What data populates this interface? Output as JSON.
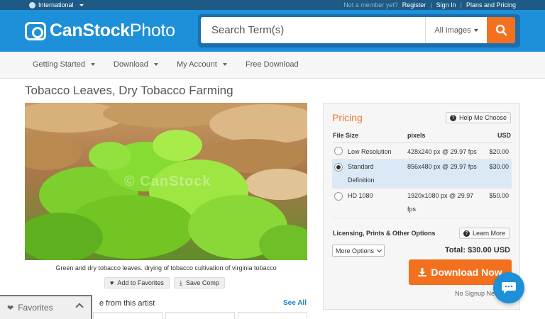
{
  "topbar": {
    "region": "International",
    "not_member": "Not a member yet?",
    "register": "Register",
    "sign_in": "Sign In",
    "plans": "Plans and Pricing"
  },
  "header": {
    "logo_bold": "CanStock",
    "logo_light": "Photo",
    "search_placeholder": "Search Term(s)",
    "filter_label": "All Images"
  },
  "nav": {
    "items": [
      {
        "label": "Getting Started"
      },
      {
        "label": "Download"
      },
      {
        "label": "My Account"
      },
      {
        "label": "Free Download"
      }
    ]
  },
  "main": {
    "title": "Tobacco Leaves, Dry Tobacco Farming",
    "watermark": "© CanStock",
    "caption": "Green and dry tobacco leaves. drying of tobacco cultivation of virginia tobacco",
    "add_favorites": "Add to Favorites",
    "save_comp": "Save Comp",
    "more_artist": "e from this artist",
    "see_all": "See All"
  },
  "favorites_bar": {
    "label": "Favorites"
  },
  "pricing": {
    "title": "Pricing",
    "help": "Help Me Choose",
    "headers": {
      "size": "File Size",
      "pixels": "pixels",
      "usd": "USD"
    },
    "rows": [
      {
        "size": "Low Resolution",
        "pixels": "428x240 px @ 29.97 fps",
        "price": "$20.00",
        "selected": false
      },
      {
        "size": "Standard Definition",
        "pixels": "856x480 px @ 29.97 fps",
        "price": "$30.00",
        "selected": true
      },
      {
        "size": "HD 1080",
        "pixels": "1920x1080 px @ 29.97 fps",
        "price": "$50.00",
        "selected": false
      }
    ],
    "licensing": "Licensing, Prints & Other Options",
    "learn_more": "Learn More",
    "more_options": "More Options",
    "total": "Total: $30.00 USD",
    "download": "Download Now",
    "no_signup": "No Signup Ne"
  },
  "colors": {
    "brand_blue": "#1e8fd9",
    "accent_orange": "#f3701f",
    "pricing_title": "#e8772e"
  }
}
